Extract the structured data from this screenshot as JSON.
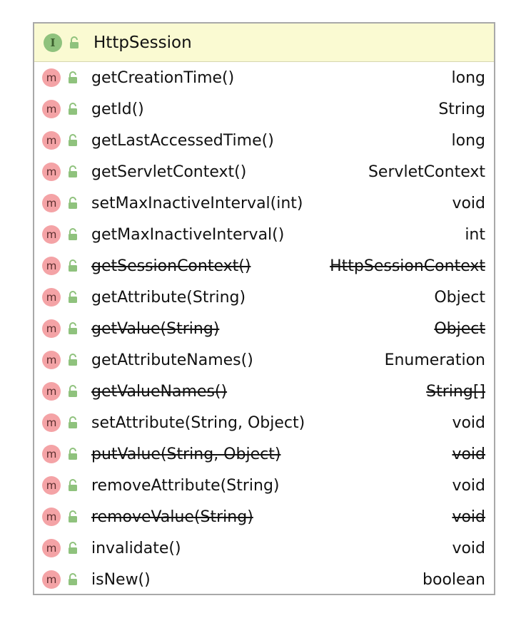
{
  "interface": {
    "badge": "I",
    "name": "HttpSession"
  },
  "methods": [
    {
      "badge": "m",
      "name": "getCreationTime()",
      "type": "long",
      "deprecated": false
    },
    {
      "badge": "m",
      "name": "getId()",
      "type": "String",
      "deprecated": false
    },
    {
      "badge": "m",
      "name": "getLastAccessedTime()",
      "type": "long",
      "deprecated": false
    },
    {
      "badge": "m",
      "name": "getServletContext()",
      "type": "ServletContext",
      "deprecated": false
    },
    {
      "badge": "m",
      "name": "setMaxInactiveInterval(int)",
      "type": "void",
      "deprecated": false
    },
    {
      "badge": "m",
      "name": "getMaxInactiveInterval()",
      "type": "int",
      "deprecated": false
    },
    {
      "badge": "m",
      "name": "getSessionContext()",
      "type": "HttpSessionContext",
      "deprecated": true
    },
    {
      "badge": "m",
      "name": "getAttribute(String)",
      "type": "Object",
      "deprecated": false
    },
    {
      "badge": "m",
      "name": "getValue(String)",
      "type": "Object",
      "deprecated": true
    },
    {
      "badge": "m",
      "name": "getAttributeNames()",
      "type": "Enumeration",
      "deprecated": false
    },
    {
      "badge": "m",
      "name": "getValueNames()",
      "type": "String[]",
      "deprecated": true
    },
    {
      "badge": "m",
      "name": "setAttribute(String, Object)",
      "type": "void",
      "deprecated": false
    },
    {
      "badge": "m",
      "name": "putValue(String, Object)",
      "type": "void",
      "deprecated": true
    },
    {
      "badge": "m",
      "name": "removeAttribute(String)",
      "type": "void",
      "deprecated": false
    },
    {
      "badge": "m",
      "name": "removeValue(String)",
      "type": "void",
      "deprecated": true
    },
    {
      "badge": "m",
      "name": "invalidate()",
      "type": "void",
      "deprecated": false
    },
    {
      "badge": "m",
      "name": "isNew()",
      "type": "boolean",
      "deprecated": false
    }
  ]
}
